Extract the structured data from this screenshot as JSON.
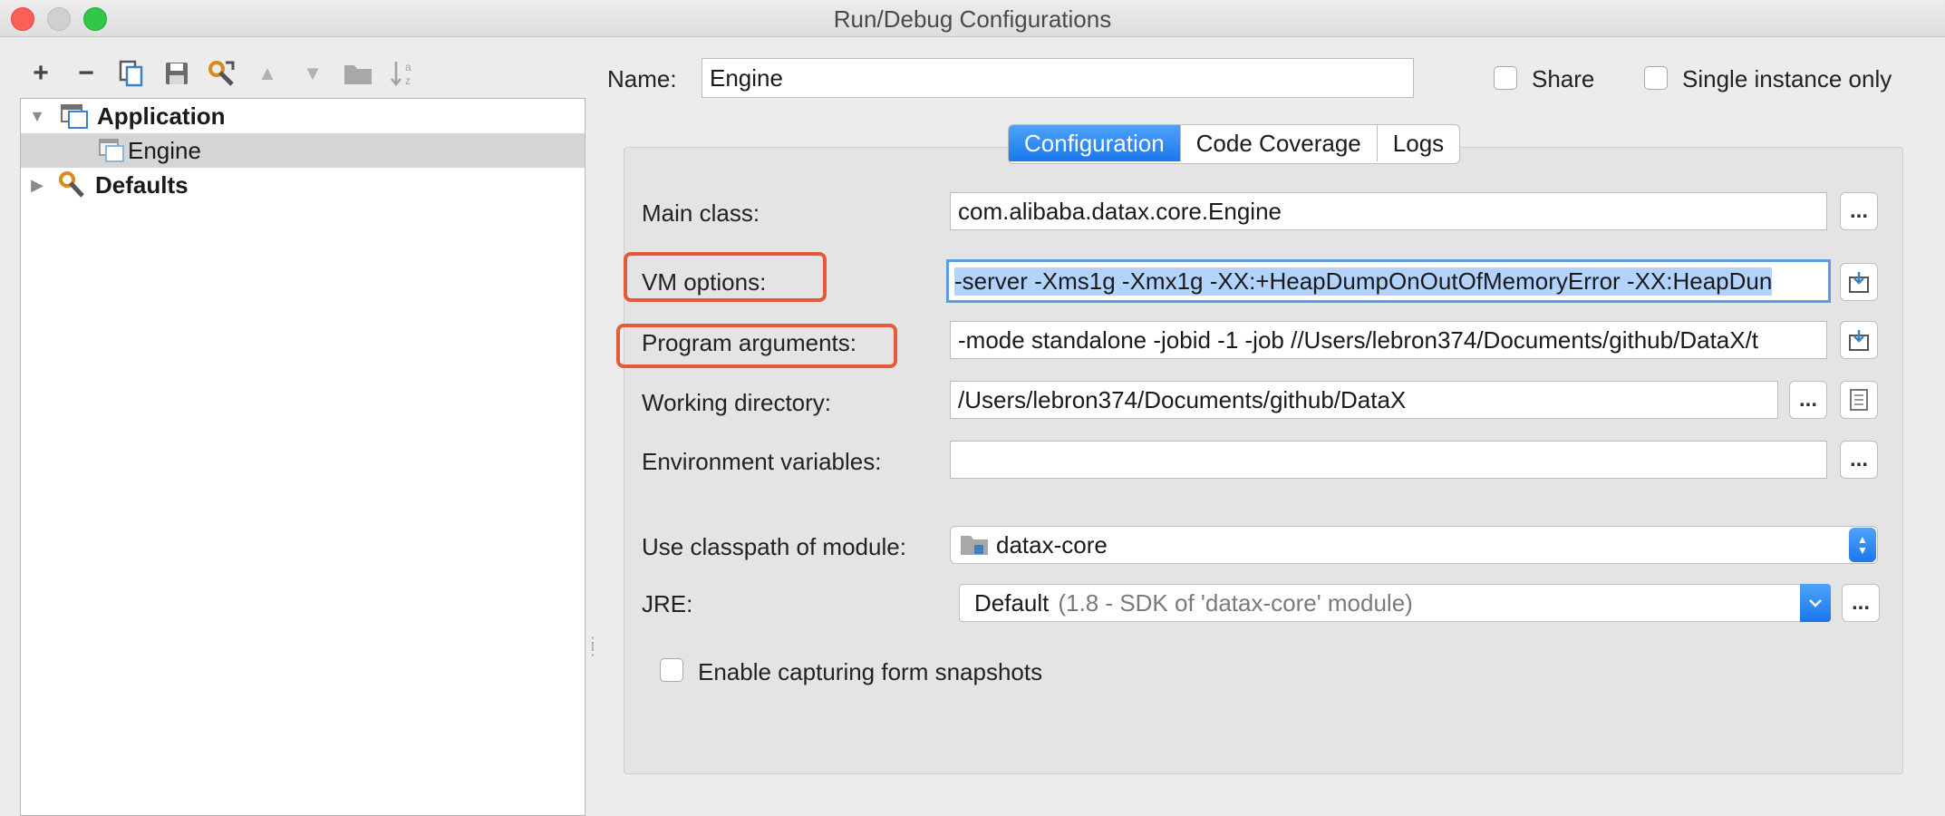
{
  "window": {
    "title": "Run/Debug Configurations"
  },
  "toolbar": {
    "add": "+",
    "remove": "−"
  },
  "tree": {
    "items": [
      {
        "label": "Application"
      },
      {
        "label": "Engine"
      },
      {
        "label": "Defaults"
      }
    ]
  },
  "header": {
    "name_label": "Name:",
    "name_value": "Engine",
    "share_label": "Share",
    "single_instance_label": "Single instance only"
  },
  "tabs": [
    {
      "label": "Configuration",
      "active": true
    },
    {
      "label": "Code Coverage"
    },
    {
      "label": "Logs"
    }
  ],
  "form": {
    "main_class_label": "Main class:",
    "main_class_value": "com.alibaba.datax.core.Engine",
    "vm_options_label": "VM options:",
    "vm_options_value": "-server -Xms1g -Xmx1g -XX:+HeapDumpOnOutOfMemoryError -XX:HeapDun",
    "program_args_label": "Program arguments:",
    "program_args_value": "-mode standalone -jobid -1 -job //Users/lebron374/Documents/github/DataX/t",
    "working_dir_label": "Working directory:",
    "working_dir_value": "/Users/lebron374/Documents/github/DataX",
    "env_vars_label": "Environment variables:",
    "env_vars_value": "",
    "classpath_label": "Use classpath of module:",
    "classpath_value": "datax-core",
    "jre_label": "JRE:",
    "jre_value": "Default",
    "jre_detail": "(1.8 - SDK of 'datax-core' module)",
    "snapshots_label": "Enable capturing form snapshots",
    "ellipsis": "..."
  },
  "colors": {
    "accent": "#1a78ec",
    "highlight": "#e55a38",
    "selection": "#b3d3fd"
  }
}
